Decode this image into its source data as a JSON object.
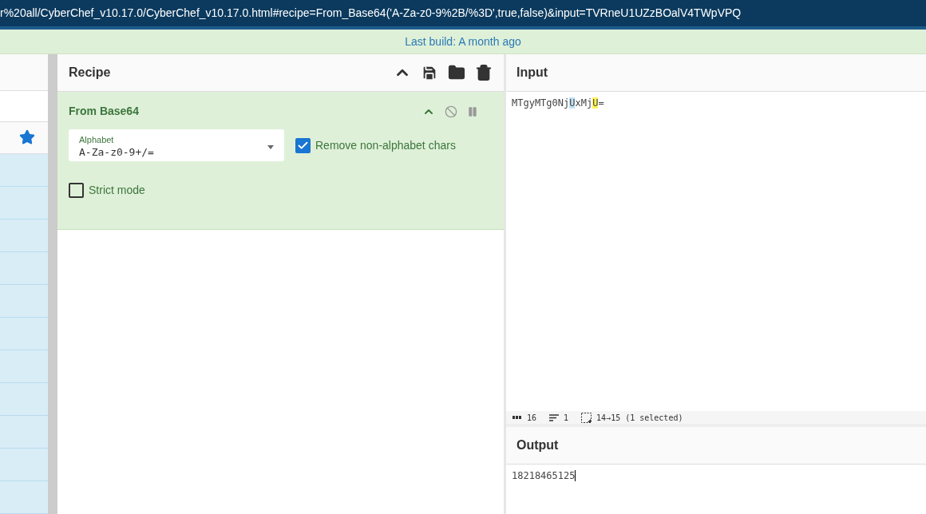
{
  "address_bar": {
    "url": "r%20all/CyberChef_v10.17.0/CyberChef_v10.17.0.html#recipe=From_Base64('A-Za-z0-9%2B/%3D',true,false)&input=TVRneU1UZzBOalV4TWpVPQ"
  },
  "banner": {
    "text": "Last build: A month ago"
  },
  "operations": {
    "favourite": true
  },
  "recipe": {
    "title": "Recipe",
    "operation": {
      "title": "From Base64",
      "disabled": false,
      "paused": false,
      "alphabet": {
        "label": "Alphabet",
        "value": "A-Za-z0-9+/="
      },
      "options": [
        {
          "label": "Remove non-alphabet chars",
          "checked": true
        },
        {
          "label": "Strict mode",
          "checked": false
        }
      ]
    }
  },
  "input": {
    "title": "Input",
    "segments": [
      {
        "text": "MTgyMTg0Nj",
        "kind": "plain"
      },
      {
        "text": "U",
        "kind": "match"
      },
      {
        "text": "xMj",
        "kind": "plain"
      },
      {
        "text": "U",
        "kind": "selection"
      },
      {
        "text": "=",
        "kind": "plain"
      }
    ],
    "status": {
      "length": "16",
      "lines": "1",
      "selection": "14→15 (1 selected)"
    }
  },
  "output": {
    "title": "Output",
    "value": "18218465125"
  }
}
